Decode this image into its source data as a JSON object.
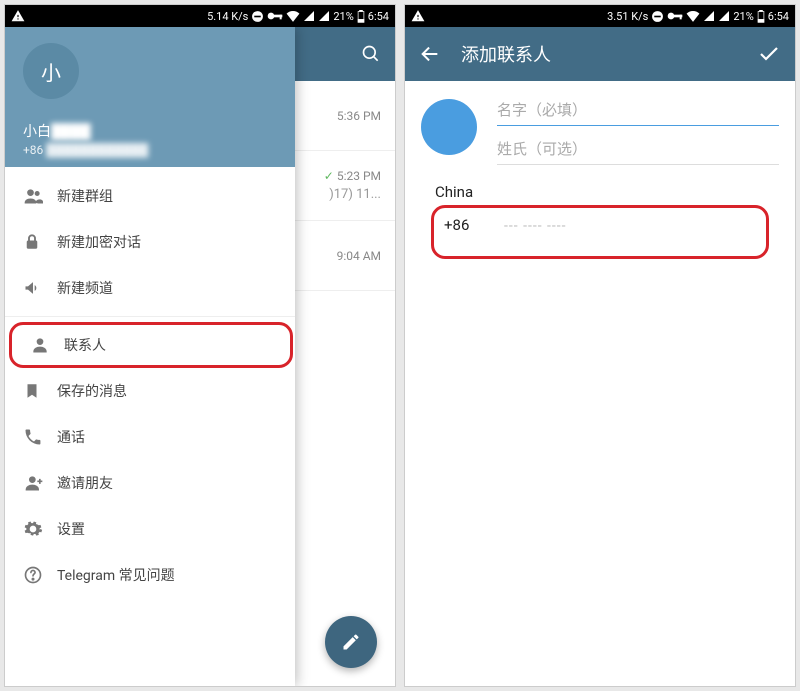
{
  "status": {
    "left_speed": "5.14 K/s",
    "right_speed": "3.51 K/s",
    "battery": "21%",
    "time": "6:54"
  },
  "left": {
    "drawer": {
      "avatar_letter": "小",
      "name_visible": "小白",
      "phone_prefix": "+86",
      "menu": [
        {
          "id": "new-group",
          "label": "新建群组"
        },
        {
          "id": "new-secret",
          "label": "新建加密对话"
        },
        {
          "id": "new-channel",
          "label": "新建频道"
        },
        {
          "id": "contacts",
          "label": "联系人",
          "hl": true
        },
        {
          "id": "saved",
          "label": "保存的消息"
        },
        {
          "id": "calls",
          "label": "通话"
        },
        {
          "id": "invite",
          "label": "邀请朋友"
        },
        {
          "id": "settings",
          "label": "设置"
        },
        {
          "id": "faq",
          "label": "Telegram 常见问题"
        }
      ]
    },
    "chats": [
      {
        "time": "5:36 PM",
        "check": false,
        "snippet": ""
      },
      {
        "time": "5:23 PM",
        "check": true,
        "snippet": ")17) 11..."
      },
      {
        "time": "9:04 AM",
        "check": false,
        "snippet": ""
      }
    ]
  },
  "right": {
    "title": "添加联系人",
    "first_name_ph": "名字（必填）",
    "last_name_ph": "姓氏（可选）",
    "country": "China",
    "country_code": "+86",
    "number_ph": "--- ---- ----"
  }
}
